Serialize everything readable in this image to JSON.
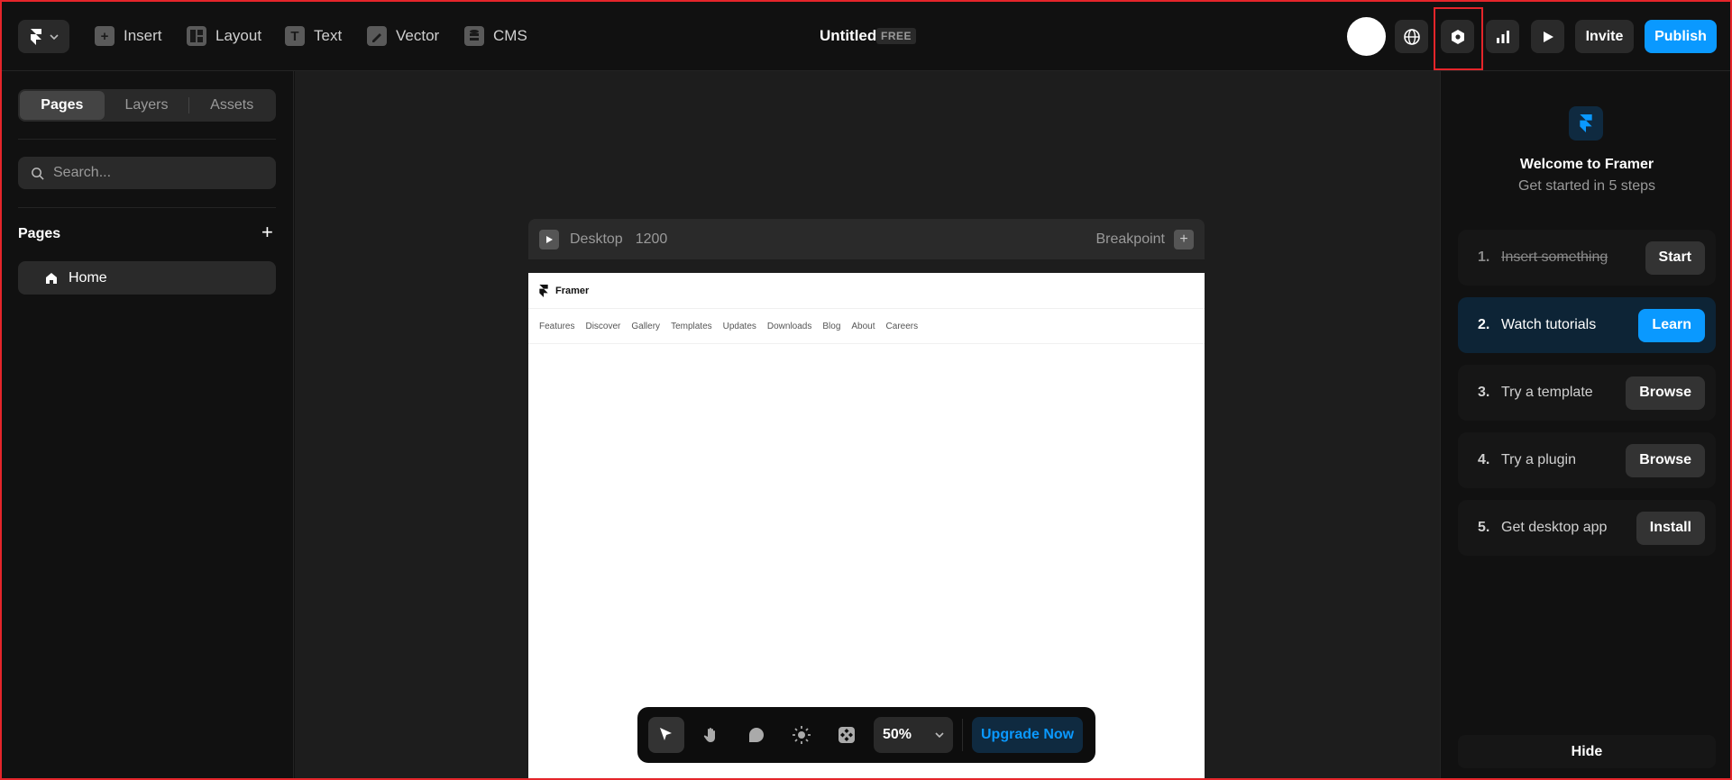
{
  "topbar": {
    "tools": [
      {
        "label": "Insert",
        "icon": "plus-square-icon"
      },
      {
        "label": "Layout",
        "icon": "layout-icon"
      },
      {
        "label": "Text",
        "icon": "text-icon"
      },
      {
        "label": "Vector",
        "icon": "pen-icon"
      },
      {
        "label": "CMS",
        "icon": "database-icon"
      }
    ],
    "title": "Untitled",
    "plan_badge": "FREE",
    "invite_label": "Invite",
    "publish_label": "Publish",
    "accent": "#0a99ff",
    "highlight_color": "#e5252a"
  },
  "sidebar": {
    "tabs": [
      "Pages",
      "Layers",
      "Assets"
    ],
    "active_tab": "Pages",
    "search_placeholder": "Search...",
    "section_title": "Pages",
    "pages": [
      "Home"
    ]
  },
  "canvas": {
    "breakpoint_name": "Desktop",
    "breakpoint_width": "1200",
    "breakpoint_label": "Breakpoint",
    "preview": {
      "brand": "Framer",
      "nav": [
        "Features",
        "Discover",
        "Gallery",
        "Templates",
        "Updates",
        "Downloads",
        "Blog",
        "About",
        "Careers"
      ]
    }
  },
  "toolbar": {
    "zoom": "50%",
    "upgrade_label": "Upgrade Now"
  },
  "welcome": {
    "title": "Welcome to Framer",
    "subtitle": "Get started in 5 steps",
    "steps": [
      {
        "num": "1.",
        "label": "Insert something",
        "action": "Start",
        "done": true
      },
      {
        "num": "2.",
        "label": "Watch tutorials",
        "action": "Learn",
        "active": true
      },
      {
        "num": "3.",
        "label": "Try a template",
        "action": "Browse"
      },
      {
        "num": "4.",
        "label": "Try a plugin",
        "action": "Browse"
      },
      {
        "num": "5.",
        "label": "Get desktop app",
        "action": "Install"
      }
    ],
    "hide_label": "Hide"
  }
}
